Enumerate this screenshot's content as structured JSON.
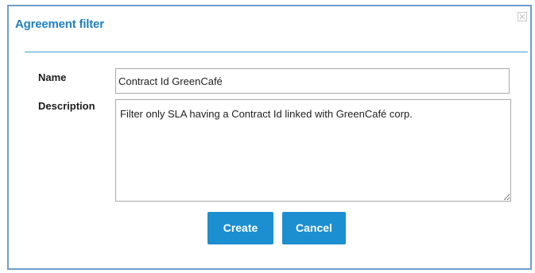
{
  "dialog": {
    "title": "Agreement filter",
    "close_icon": "close-icon"
  },
  "form": {
    "name_label": "Name",
    "name_value": "Contract Id GreenCafé",
    "description_label": "Description",
    "description_value": "Filter only SLA having a Contract Id linked with GreenCafé corp."
  },
  "buttons": {
    "create_label": "Create",
    "cancel_label": "Cancel"
  },
  "colors": {
    "accent": "#1c8fd0",
    "title": "#1f7fc0",
    "border": "#6f9ecb"
  }
}
